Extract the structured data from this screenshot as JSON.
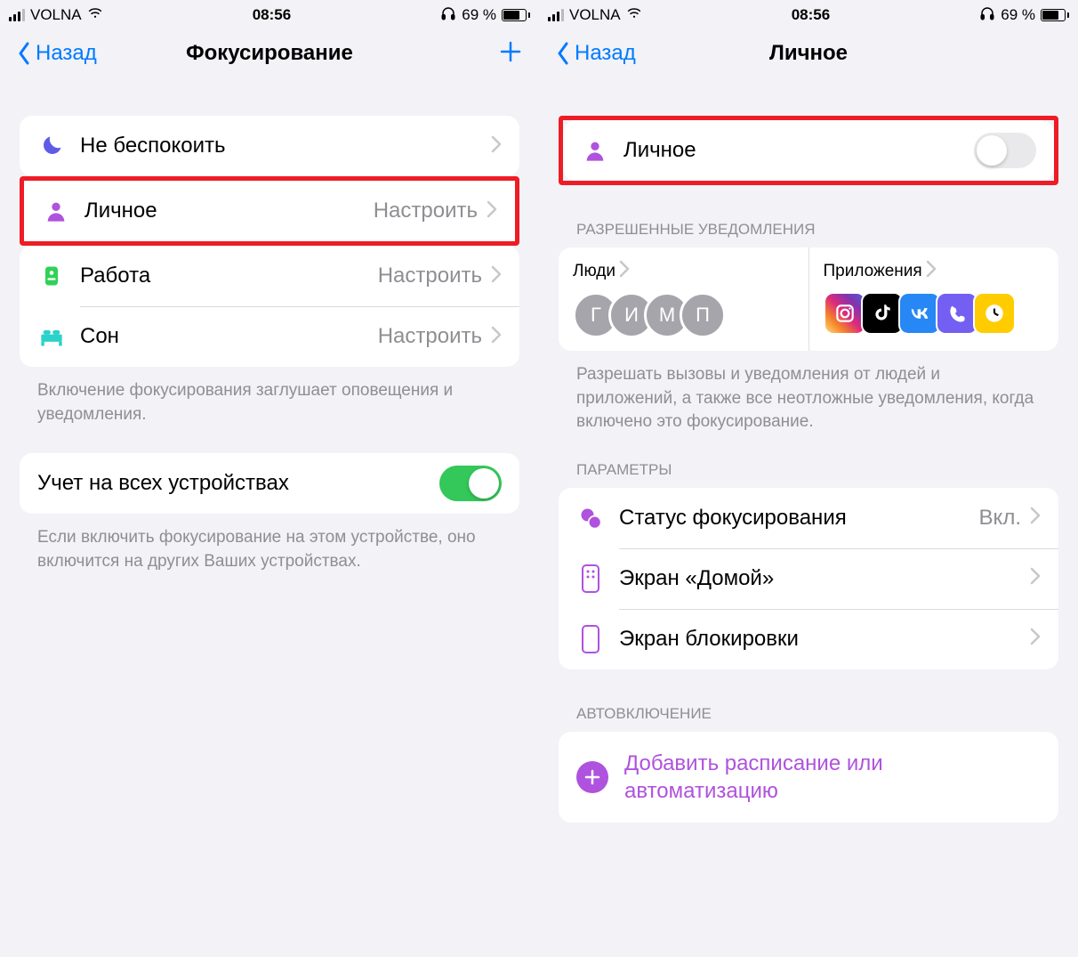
{
  "status": {
    "carrier": "VOLNA",
    "time": "08:56",
    "battery_pct": "69 %"
  },
  "left": {
    "nav_back": "Назад",
    "nav_title": "Фокусирование",
    "focus_modes": [
      {
        "label": "Не беспокоить",
        "detail": ""
      },
      {
        "label": "Личное",
        "detail": "Настроить"
      },
      {
        "label": "Работа",
        "detail": "Настроить"
      },
      {
        "label": "Сон",
        "detail": "Настроить"
      }
    ],
    "focus_footer": "Включение фокусирования заглушает оповещения и уведомления.",
    "share_label": "Учет на всех устройствах",
    "share_footer": "Если включить фокусирование на этом устройстве, оно включится на других Ваших устройствах."
  },
  "right": {
    "nav_back": "Назад",
    "nav_title": "Личное",
    "toggle_label": "Личное",
    "allowed_header": "РАЗРЕШЕННЫЕ УВЕДОМЛЕНИЯ",
    "people_label": "Люди",
    "apps_label": "Приложения",
    "people_initials": [
      "Г",
      "И",
      "М",
      "П"
    ],
    "app_colors": [
      "linear-gradient(45deg,#feda77,#f58529,#dd2a7b,#8134af,#515bd4)",
      "#000",
      "#2787f5",
      "#7360f2",
      "#ffcc00"
    ],
    "allowed_footer": "Разрешать вызовы и уведомления от людей и приложений, а также все неотложные уведомления, когда включено это фокусирование.",
    "params_header": "ПАРАМЕТРЫ",
    "params": [
      {
        "label": "Статус фокусирования",
        "detail": "Вкл."
      },
      {
        "label": "Экран «Домой»",
        "detail": ""
      },
      {
        "label": "Экран блокировки",
        "detail": ""
      }
    ],
    "auto_header": "АВТОВКЛЮЧЕНИЕ",
    "add_schedule_text": "Добавить расписание или автоматизацию"
  }
}
